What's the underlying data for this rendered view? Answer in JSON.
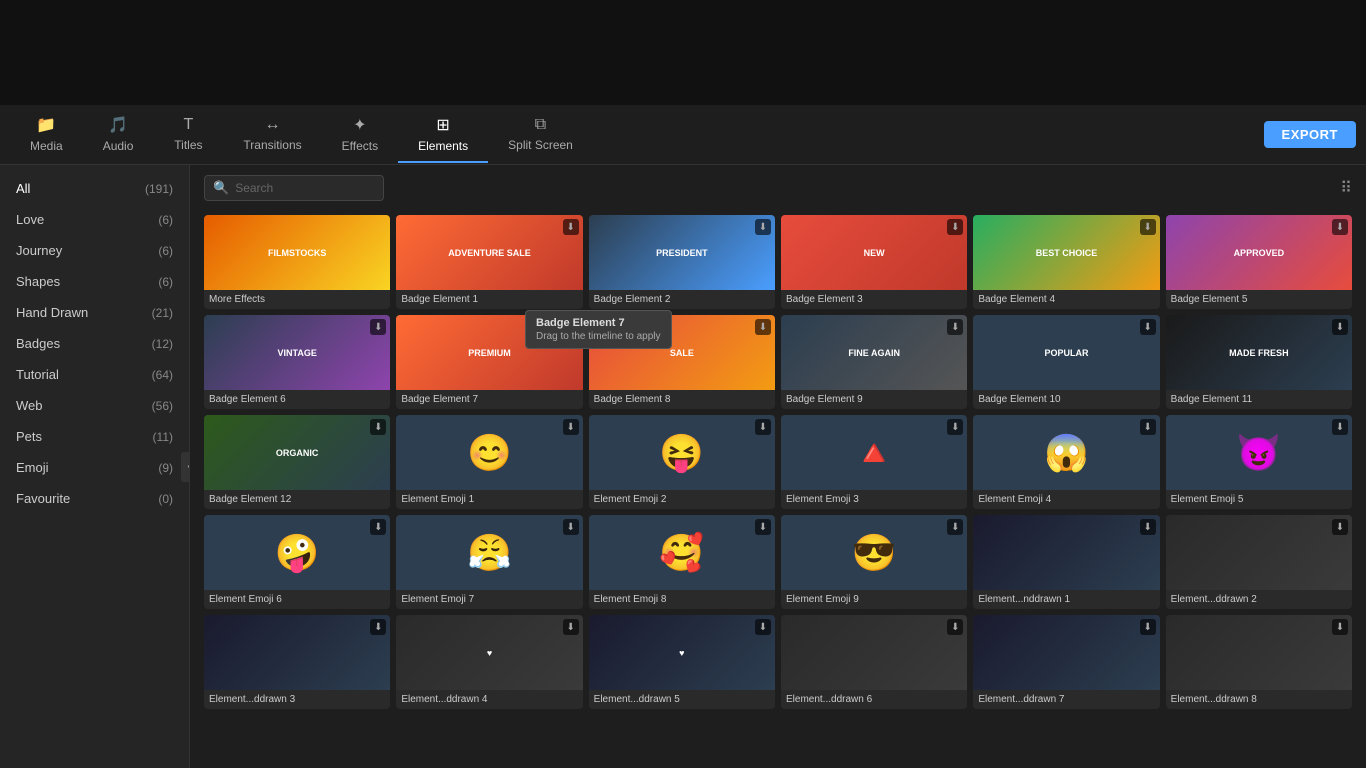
{
  "topBar": {
    "height": 105
  },
  "toolbar": {
    "tabs": [
      {
        "id": "media",
        "label": "Media",
        "icon": "📁"
      },
      {
        "id": "audio",
        "label": "Audio",
        "icon": "🎵"
      },
      {
        "id": "titles",
        "label": "Titles",
        "icon": "T"
      },
      {
        "id": "transitions",
        "label": "Transitions",
        "icon": "↔"
      },
      {
        "id": "effects",
        "label": "Effects",
        "icon": "✦"
      },
      {
        "id": "elements",
        "label": "Elements",
        "icon": "⊞",
        "active": true
      },
      {
        "id": "splitscreen",
        "label": "Split Screen",
        "icon": "⧉"
      }
    ],
    "export_label": "EXPORT"
  },
  "sidebar": {
    "items": [
      {
        "label": "All",
        "count": "(191)"
      },
      {
        "label": "Love",
        "count": "(6)"
      },
      {
        "label": "Journey",
        "count": "(6)"
      },
      {
        "label": "Shapes",
        "count": "(6)"
      },
      {
        "label": "Hand Drawn",
        "count": "(21)"
      },
      {
        "label": "Badges",
        "count": "(12)"
      },
      {
        "label": "Tutorial",
        "count": "(64)"
      },
      {
        "label": "Web",
        "count": "(56)"
      },
      {
        "label": "Pets",
        "count": "(11)"
      },
      {
        "label": "Emoji",
        "count": "(9)"
      },
      {
        "label": "Favourite",
        "count": "(0)"
      }
    ]
  },
  "search": {
    "placeholder": "Search"
  },
  "tooltip": {
    "title": "Badge Element 7",
    "subtitle": "Drag to the timeline to apply"
  },
  "grid": {
    "items": [
      {
        "id": "more-effects",
        "label": "More Effects",
        "thumbClass": "thumb-filmstock",
        "thumbText": "Filmstocks"
      },
      {
        "id": "badge1",
        "label": "Badge Element 1",
        "thumbClass": "thumb-badge1",
        "thumbText": "ADVENTURE SALE",
        "hasDownload": true
      },
      {
        "id": "badge2",
        "label": "Badge Element 2",
        "thumbClass": "thumb-badge2",
        "thumbText": "PRESIDENT",
        "hasDownload": true
      },
      {
        "id": "badge3",
        "label": "Badge Element 3",
        "thumbClass": "thumb-badge3",
        "thumbText": "NEW",
        "hasDownload": true
      },
      {
        "id": "badge4",
        "label": "Badge Element 4",
        "thumbClass": "thumb-badge4",
        "thumbText": "Best Choice",
        "hasDownload": true
      },
      {
        "id": "badge5",
        "label": "Badge Element 5",
        "thumbClass": "thumb-badge5",
        "thumbText": "APPROVED",
        "hasDownload": true
      },
      {
        "id": "badge6",
        "label": "Badge Element 6",
        "thumbClass": "thumb-badge6",
        "thumbText": "VINTAGE",
        "hasDownload": true
      },
      {
        "id": "badge7",
        "label": "Badge Element 7",
        "thumbClass": "thumb-badge1",
        "thumbText": "Premium",
        "hasDownload": true,
        "hasTooltip": true
      },
      {
        "id": "badge8",
        "label": "Badge Element 8",
        "thumbClass": "thumb-badge8",
        "thumbText": "SALE",
        "hasDownload": true
      },
      {
        "id": "badge9",
        "label": "Badge Element 9",
        "thumbClass": "thumb-badge9",
        "thumbText": "Fine Again",
        "hasDownload": true
      },
      {
        "id": "badge10",
        "label": "Badge Element 10",
        "thumbClass": "thumb-badge10",
        "thumbText": "POPULAR",
        "hasDownload": true
      },
      {
        "id": "badge11",
        "label": "Badge Element 11",
        "thumbClass": "thumb-badge11",
        "thumbText": "MADE FRESH",
        "hasDownload": true
      },
      {
        "id": "badge12",
        "label": "Badge Element 12",
        "thumbClass": "thumb-badge12",
        "thumbText": "ORGANIC",
        "hasDownload": true
      },
      {
        "id": "emoji1",
        "label": "Element Emoji 1",
        "thumbClass": "thumb-emoji-bg",
        "thumbEmoji": "😊",
        "hasDownload": true
      },
      {
        "id": "emoji2",
        "label": "Element Emoji 2",
        "thumbClass": "thumb-emoji-bg",
        "thumbEmoji": "😝",
        "hasDownload": true
      },
      {
        "id": "emoji3",
        "label": "Element Emoji 3",
        "thumbClass": "thumb-emoji-bg",
        "thumbEmoji": "🔺",
        "hasDownload": true
      },
      {
        "id": "emoji4",
        "label": "Element Emoji 4",
        "thumbClass": "thumb-emoji-bg",
        "thumbEmoji": "😱",
        "hasDownload": true
      },
      {
        "id": "emoji5",
        "label": "Element Emoji 5",
        "thumbClass": "thumb-emoji-bg",
        "thumbEmoji": "😈",
        "hasDownload": true
      },
      {
        "id": "emoji6",
        "label": "Element Emoji 6",
        "thumbClass": "thumb-emoji-bg",
        "thumbEmoji": "🤪",
        "hasDownload": true
      },
      {
        "id": "emoji7",
        "label": "Element Emoji 7",
        "thumbClass": "thumb-emoji-bg",
        "thumbEmoji": "😤",
        "hasDownload": true
      },
      {
        "id": "emoji8",
        "label": "Element Emoji 8",
        "thumbClass": "thumb-emoji-bg",
        "thumbEmoji": "🥰",
        "hasDownload": true
      },
      {
        "id": "emoji9",
        "label": "Element Emoji 9",
        "thumbClass": "thumb-emoji-bg",
        "thumbEmoji": "😎",
        "hasDownload": true
      },
      {
        "id": "handdrawn1",
        "label": "Element...nddrawn 1",
        "thumbClass": "thumb-dark",
        "thumbText": "",
        "hasDownload": true
      },
      {
        "id": "handdrawn2",
        "label": "Element...ddrawn 2",
        "thumbClass": "thumb-gray",
        "thumbText": "",
        "hasDownload": true
      },
      {
        "id": "handdrawn3",
        "label": "Element...ddrawn 3",
        "thumbClass": "thumb-dark",
        "thumbText": "",
        "hasDownload": true
      },
      {
        "id": "handdrawn4",
        "label": "Element...ddrawn 4",
        "thumbClass": "thumb-gray",
        "thumbText": "♥",
        "hasDownload": true
      },
      {
        "id": "handdrawn5",
        "label": "Element...ddrawn 5",
        "thumbClass": "thumb-dark",
        "thumbText": "♥",
        "hasDownload": true
      },
      {
        "id": "handdrawn6",
        "label": "Element...ddrawn 6",
        "thumbClass": "thumb-gray",
        "thumbText": "",
        "hasDownload": true
      },
      {
        "id": "handdrawn7",
        "label": "Element...ddrawn 7",
        "thumbClass": "thumb-dark",
        "thumbText": "",
        "hasDownload": true
      },
      {
        "id": "handdrawn8",
        "label": "Element...ddrawn 8",
        "thumbClass": "thumb-gray",
        "thumbText": "",
        "hasDownload": true
      }
    ]
  }
}
